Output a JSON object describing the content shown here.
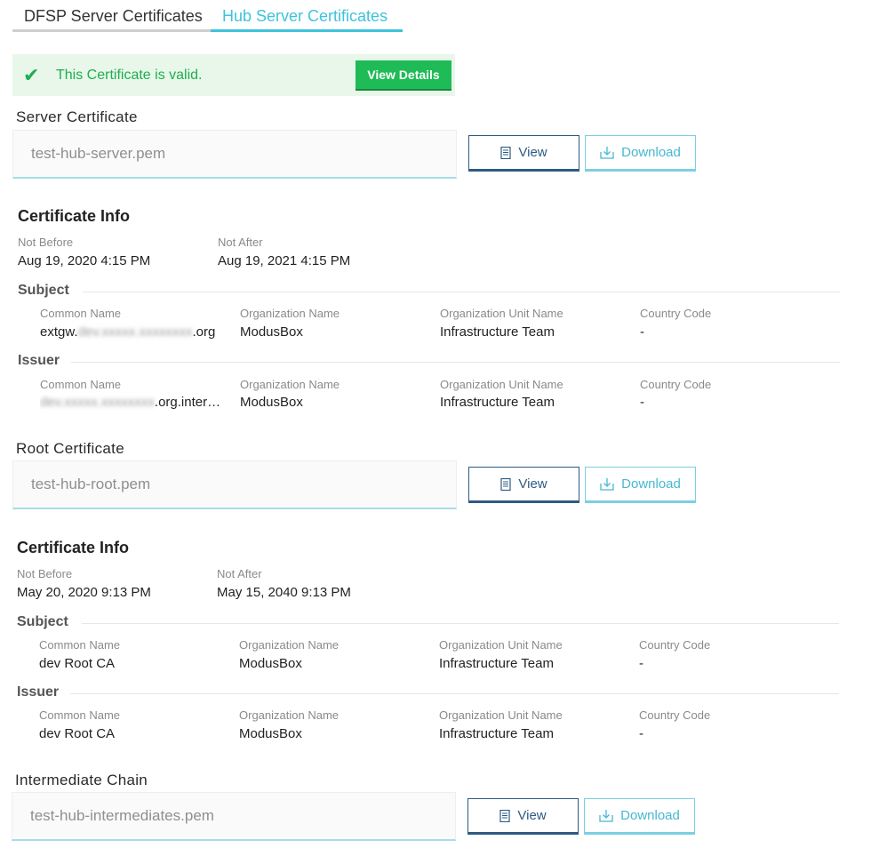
{
  "tabs": {
    "dfsp": "DFSP Server Certificates",
    "hub": "Hub Server Certificates"
  },
  "banner": {
    "text": "This Certificate is valid.",
    "button": "View Details",
    "check_icon": "✔"
  },
  "buttons": {
    "view": "View",
    "download": "Download"
  },
  "labels": {
    "certificate_info": "Certificate Info",
    "not_before": "Not Before",
    "not_after": "Not After",
    "subject": "Subject",
    "issuer": "Issuer",
    "common_name": "Common Name",
    "organization_name": "Organization Name",
    "organization_unit_name": "Organization Unit Name",
    "country_code": "Country Code"
  },
  "server": {
    "label": "Server Certificate",
    "file": "test-hub-server.pem",
    "not_before": "Aug 19, 2020 4:15 PM",
    "not_after": "Aug 19, 2021 4:15 PM",
    "subject": {
      "cn_prefix": "extgw.",
      "cn_redacted": "dev.xxxxx.xxxxxxxx",
      "cn_suffix": ".org",
      "org": "ModusBox",
      "ou": "Infrastructure Team",
      "country": "-"
    },
    "issuer": {
      "cn_redacted": "dev.xxxxx.xxxxxxxx",
      "cn_suffix": ".org.inter…",
      "org": "ModusBox",
      "ou": "Infrastructure Team",
      "country": "-"
    }
  },
  "root": {
    "label": "Root Certificate",
    "file": "test-hub-root.pem",
    "not_before": "May 20, 2020 9:13 PM",
    "not_after": "May 15, 2040 9:13 PM",
    "subject": {
      "cn": "dev Root CA",
      "org": "ModusBox",
      "ou": "Infrastructure Team",
      "country": "-"
    },
    "issuer": {
      "cn": "dev Root CA",
      "org": "ModusBox",
      "ou": "Infrastructure Team",
      "country": "-"
    }
  },
  "intermediate": {
    "label": "Intermediate Chain",
    "file": "test-hub-intermediates.pem"
  },
  "colors": {
    "accent": "#3ec3dc",
    "valid_green": "#1fae4f",
    "view_blue": "#2d5a82"
  }
}
